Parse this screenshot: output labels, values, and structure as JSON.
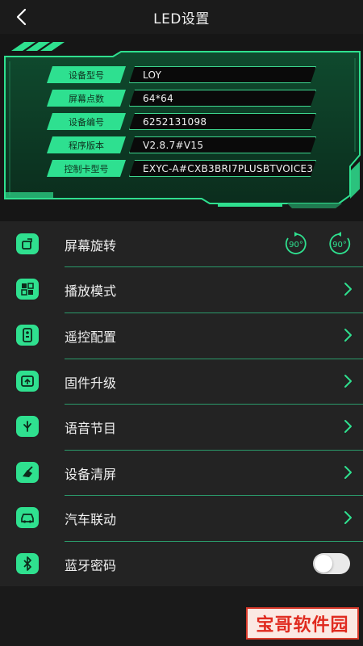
{
  "header": {
    "title": "LED设置"
  },
  "device_info": {
    "rows": [
      {
        "label": "设备型号",
        "value": "LOY"
      },
      {
        "label": "屏幕点数",
        "value": "64*64"
      },
      {
        "label": "设备编号",
        "value": "6252131098"
      },
      {
        "label": "程序版本",
        "value": "V2.8.7#V15"
      },
      {
        "label": "控制卡型号",
        "value": "EXYC-A#CXB3BRI7PLUSBTVOICE3"
      }
    ]
  },
  "menu": {
    "items": [
      {
        "label": "屏幕旋转",
        "icon": "rotate-screen-icon"
      },
      {
        "label": "播放模式",
        "icon": "play-mode-icon"
      },
      {
        "label": "遥控配置",
        "icon": "remote-icon"
      },
      {
        "label": "固件升级",
        "icon": "firmware-upgrade-icon"
      },
      {
        "label": "语音节目",
        "icon": "voice-program-icon"
      },
      {
        "label": "设备清屏",
        "icon": "clear-screen-icon"
      },
      {
        "label": "汽车联动",
        "icon": "car-link-icon"
      },
      {
        "label": "蓝牙密码",
        "icon": "bluetooth-icon"
      }
    ],
    "rotate_left_label": "90°",
    "rotate_right_label": "90°",
    "bluetooth_password_enabled": false
  },
  "watermark": {
    "text": "宝哥软件园"
  },
  "colors": {
    "accent": "#2fe08f",
    "background": "#1c1c1c",
    "panel": "#0e3a25",
    "menu_background": "#232323",
    "divider": "#2a9a6a"
  }
}
